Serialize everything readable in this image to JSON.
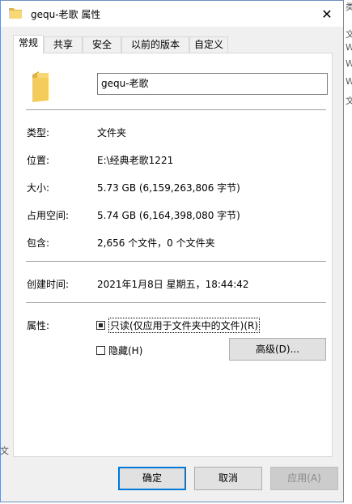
{
  "window": {
    "title": "gequ-老歌 属性",
    "close_glyph": "✕"
  },
  "tabs": [
    {
      "label": "常规"
    },
    {
      "label": "共享"
    },
    {
      "label": "安全"
    },
    {
      "label": "以前的版本"
    },
    {
      "label": "自定义"
    }
  ],
  "general": {
    "folder_name": "gequ-老歌",
    "type_label": "类型:",
    "type_value": "文件夹",
    "location_label": "位置:",
    "location_value": "E:\\经典老歌1221",
    "size_label": "大小:",
    "size_value": "5.73 GB (6,159,263,806 字节)",
    "size_on_disk_label": "占用空间:",
    "size_on_disk_value": "5.74 GB (6,164,398,080 字节)",
    "contains_label": "包含:",
    "contains_value": "2,656 个文件，0 个文件夹",
    "created_label": "创建时间:",
    "created_value": "2021年1月8日 星期五，18:44:42",
    "attributes_label": "属性:",
    "readonly_label": "只读(仅应用于文件夹中的文件)(R)",
    "readonly_state": "mixed",
    "hidden_label": "隐藏(H)",
    "hidden_state": "unchecked",
    "advanced_label": "高级(D)..."
  },
  "footer": {
    "ok_label": "确定",
    "cancel_label": "取消",
    "apply_label": "应用(A)"
  },
  "background": {
    "right_glyphs": [
      "类",
      "文",
      "W",
      "W",
      "W",
      "文"
    ],
    "left_glyph": "文"
  },
  "colors": {
    "folder_yellow": "#f8d775",
    "folder_dark": "#e0b443",
    "focus_blue": "#0078d7"
  },
  "icons": {
    "title_icon": "folder-icon",
    "large_icon": "folder-icon",
    "close": "close-icon"
  }
}
